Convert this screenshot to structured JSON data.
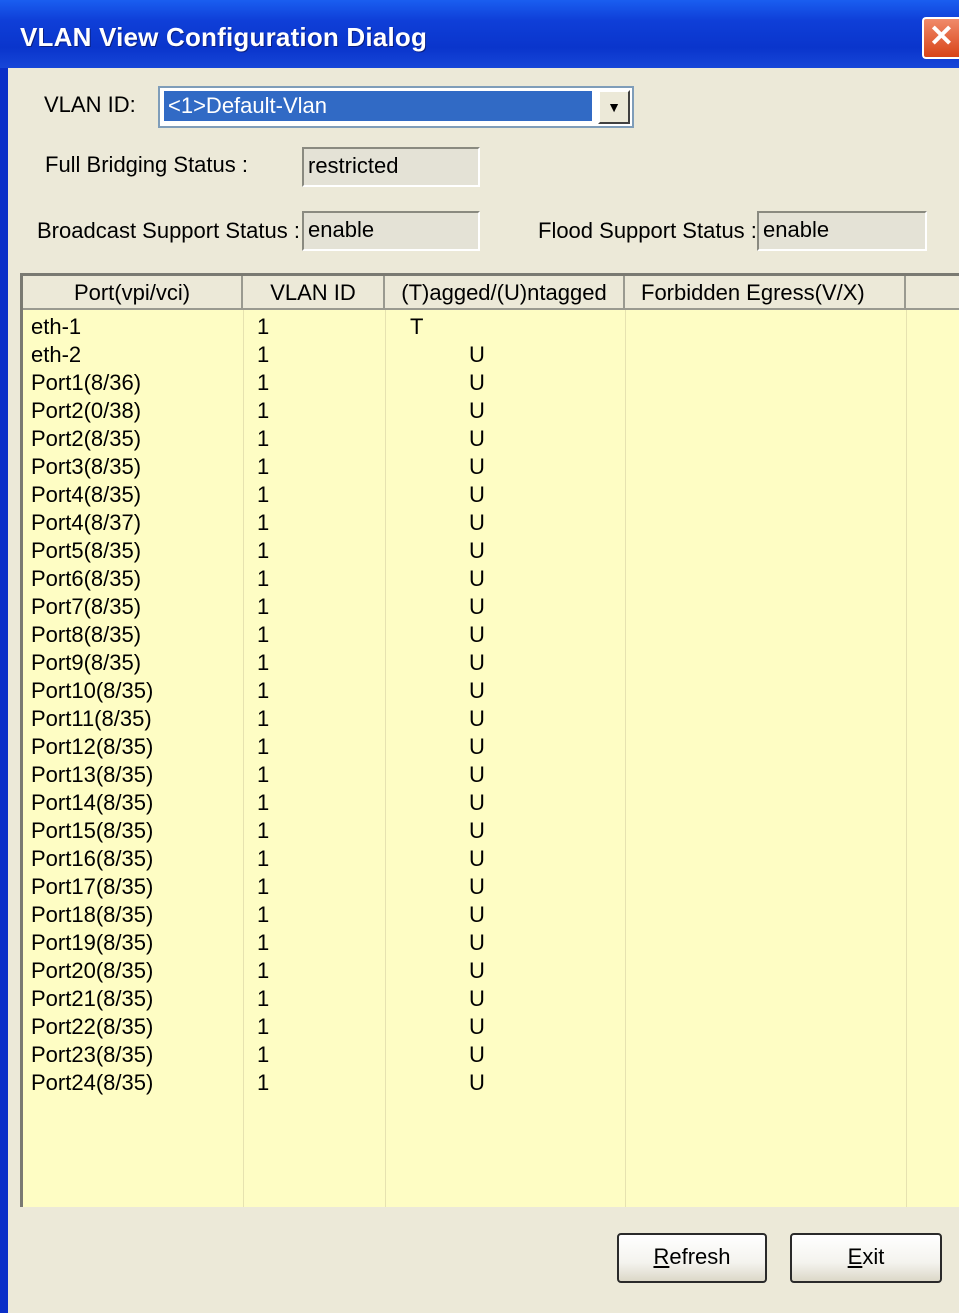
{
  "window": {
    "title": "VLAN View Configuration Dialog",
    "close_glyph": "✕"
  },
  "form": {
    "vlan_id_label": "VLAN ID:",
    "vlan_id_value": "<1>Default-Vlan",
    "full_bridging_label": "Full Bridging Status :",
    "full_bridging_value": "restricted",
    "broadcast_label": "Broadcast Support Status :",
    "broadcast_value": "enable",
    "flood_label": "Flood Support Status :",
    "flood_value": "enable"
  },
  "table": {
    "columns": [
      "Port(vpi/vci)",
      "VLAN ID",
      "(T)agged/(U)ntagged",
      "Forbidden Egress(V/X)"
    ],
    "rows": [
      [
        "eth-1",
        "1",
        "T",
        ""
      ],
      [
        "eth-2",
        "1",
        "U",
        ""
      ],
      [
        "Port1(8/36)",
        "1",
        "U",
        ""
      ],
      [
        "Port2(0/38)",
        "1",
        "U",
        ""
      ],
      [
        "Port2(8/35)",
        "1",
        "U",
        ""
      ],
      [
        "Port3(8/35)",
        "1",
        "U",
        ""
      ],
      [
        "Port4(8/35)",
        "1",
        "U",
        ""
      ],
      [
        "Port4(8/37)",
        "1",
        "U",
        ""
      ],
      [
        "Port5(8/35)",
        "1",
        "U",
        ""
      ],
      [
        "Port6(8/35)",
        "1",
        "U",
        ""
      ],
      [
        "Port7(8/35)",
        "1",
        "U",
        ""
      ],
      [
        "Port8(8/35)",
        "1",
        "U",
        ""
      ],
      [
        "Port9(8/35)",
        "1",
        "U",
        ""
      ],
      [
        "Port10(8/35)",
        "1",
        "U",
        ""
      ],
      [
        "Port11(8/35)",
        "1",
        "U",
        ""
      ],
      [
        "Port12(8/35)",
        "1",
        "U",
        ""
      ],
      [
        "Port13(8/35)",
        "1",
        "U",
        ""
      ],
      [
        "Port14(8/35)",
        "1",
        "U",
        ""
      ],
      [
        "Port15(8/35)",
        "1",
        "U",
        ""
      ],
      [
        "Port16(8/35)",
        "1",
        "U",
        ""
      ],
      [
        "Port17(8/35)",
        "1",
        "U",
        ""
      ],
      [
        "Port18(8/35)",
        "1",
        "U",
        ""
      ],
      [
        "Port19(8/35)",
        "1",
        "U",
        ""
      ],
      [
        "Port20(8/35)",
        "1",
        "U",
        ""
      ],
      [
        "Port21(8/35)",
        "1",
        "U",
        ""
      ],
      [
        "Port22(8/35)",
        "1",
        "U",
        ""
      ],
      [
        "Port23(8/35)",
        "1",
        "U",
        ""
      ],
      [
        "Port24(8/35)",
        "1",
        "U",
        ""
      ]
    ]
  },
  "buttons": {
    "refresh_mnemonic": "R",
    "refresh_rest": "efresh",
    "exit_mnemonic": "E",
    "exit_rest": "xit"
  }
}
